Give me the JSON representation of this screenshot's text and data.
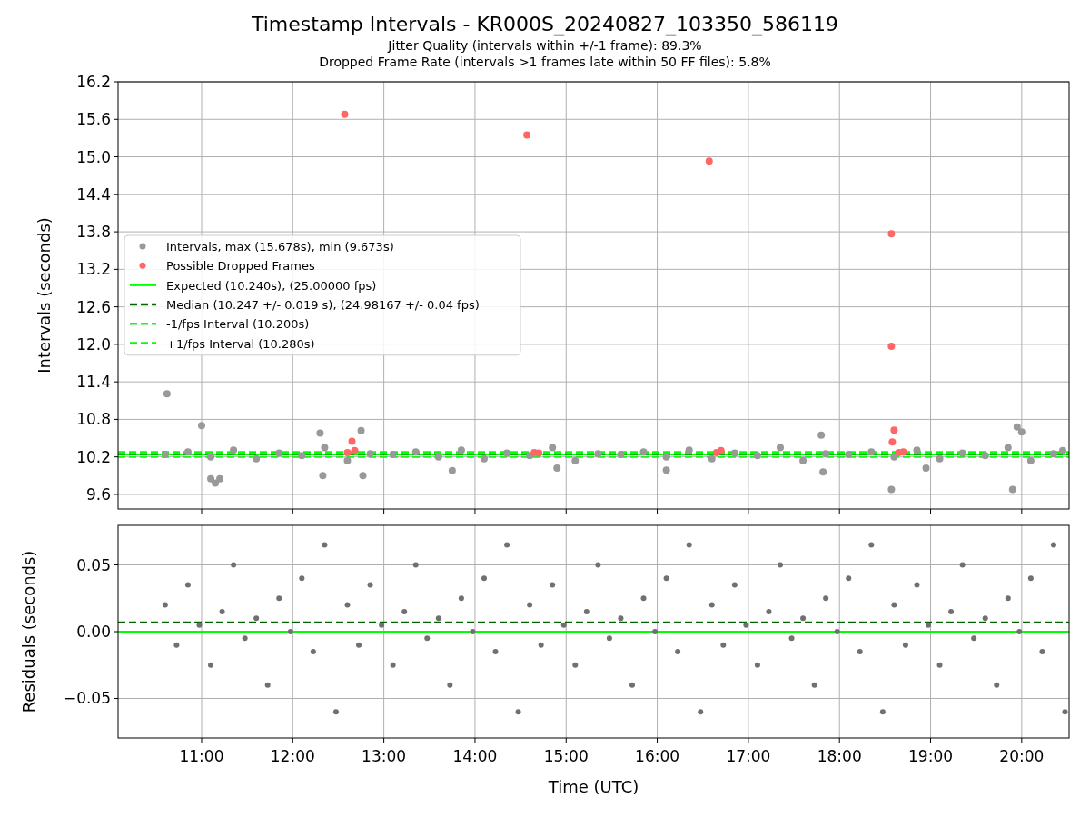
{
  "figure": {
    "title": "Timestamp Intervals - KR000S_20240827_103350_586119",
    "subtitles": [
      "Jitter Quality (intervals within +/-1 frame): 89.3%",
      "Dropped Frame Rate (intervals >1 frames late within 50 FF files): 5.8%"
    ]
  },
  "intervals_plot": {
    "chart_data": {
      "type": "scatter",
      "ylabel": "Intervals (seconds)",
      "grid": true,
      "xlim": [
        10.083,
        20.52
      ],
      "ylim": [
        9.367,
        16.2
      ],
      "yticks": [
        {
          "value": 9.6,
          "label": "9.6"
        },
        {
          "value": 10.2,
          "label": "10.2"
        },
        {
          "value": 10.8,
          "label": "10.8"
        },
        {
          "value": 11.4,
          "label": "11.4"
        },
        {
          "value": 12,
          "label": "12.0"
        },
        {
          "value": 12.6,
          "label": "12.6"
        },
        {
          "value": 13.2,
          "label": "13.2"
        },
        {
          "value": 13.8,
          "label": "13.8"
        },
        {
          "value": 14.4,
          "label": "14.4"
        },
        {
          "value": 15,
          "label": "15.0"
        },
        {
          "value": 15.6,
          "label": "15.6"
        },
        {
          "value": 16.2,
          "label": "16.2"
        }
      ],
      "series": [
        {
          "name": "Intervals, max (15.678s), min (9.673s)",
          "color": "#999999",
          "x": [
            10.6,
            10.85,
            11.1,
            11.35,
            11.6,
            11.85,
            12.1,
            12.35,
            12.6,
            12.85,
            13.1,
            13.35,
            13.6,
            13.85,
            14.1,
            14.35,
            14.6,
            14.85,
            15.1,
            15.35,
            15.6,
            15.85,
            16.1,
            16.35,
            16.6,
            16.85,
            17.1,
            17.35,
            17.6,
            17.85,
            18.1,
            18.35,
            18.6,
            18.85,
            19.1,
            19.35,
            19.6,
            19.85,
            20.1,
            20.35,
            10.62,
            11.0,
            11.1,
            11.15,
            11.2,
            12.3,
            12.33,
            12.75,
            12.77,
            13.75,
            14.9,
            16.1,
            17.8,
            17.82,
            18.57,
            18.95,
            19.9,
            19.95,
            20.0,
            20.45
          ],
          "values": [
            10.24,
            10.28,
            10.2,
            10.31,
            10.17,
            10.26,
            10.22,
            10.35,
            10.14,
            10.25,
            10.24,
            10.28,
            10.2,
            10.31,
            10.17,
            10.26,
            10.22,
            10.35,
            10.14,
            10.25,
            10.24,
            10.28,
            10.2,
            10.31,
            10.17,
            10.26,
            10.22,
            10.35,
            10.14,
            10.25,
            10.24,
            10.28,
            10.2,
            10.31,
            10.17,
            10.26,
            10.22,
            10.35,
            10.14,
            10.25,
            11.21,
            10.7,
            9.85,
            9.78,
            9.85,
            10.58,
            9.9,
            10.62,
            9.9,
            9.98,
            10.02,
            9.99,
            10.55,
            9.96,
            9.68,
            10.02,
            9.68,
            10.68,
            10.6,
            10.3
          ]
        },
        {
          "name": "Possible Dropped Frames",
          "color": "#ff6666",
          "x": [
            12.57,
            14.57,
            16.57,
            18.57,
            18.57,
            18.6,
            18.58,
            12.65,
            12.6,
            12.68,
            14.65,
            14.7,
            16.65,
            16.7,
            18.65,
            18.7
          ],
          "values": [
            15.68,
            15.35,
            14.93,
            13.77,
            11.97,
            10.63,
            10.44,
            10.45,
            10.27,
            10.3,
            10.27,
            10.26,
            10.27,
            10.3,
            10.27,
            10.28
          ]
        }
      ],
      "ref_lines": [
        {
          "axis": "y",
          "value": 10.24,
          "color": "#00ff00",
          "label": "Expected (10.240s), (25.00000 fps)"
        },
        {
          "axis": "y",
          "value": 10.247,
          "color": "#006400",
          "label": "Median (10.247 +/- 0.019 s), (24.98167 +/- 0.04 fps)"
        },
        {
          "axis": "y",
          "value": 10.2,
          "color": "#22ee22",
          "label": "-1/fps Interval (10.200s)"
        },
        {
          "axis": "y",
          "value": 10.28,
          "color": "#00ff00",
          "label": "+1/fps Interval (10.280s)"
        }
      ],
      "legend": "center left"
    }
  },
  "residuals_plot": {
    "chart_data": {
      "type": "scatter",
      "xlabel": "Time (UTC)",
      "ylabel": "Residuals (seconds)",
      "grid": true,
      "xlim": [
        10.083,
        20.52
      ],
      "ylim": [
        -0.0796,
        0.0796
      ],
      "xticks": [
        {
          "value": 11,
          "label": "11:00"
        },
        {
          "value": 12,
          "label": "12:00"
        },
        {
          "value": 13,
          "label": "13:00"
        },
        {
          "value": 14,
          "label": "14:00"
        },
        {
          "value": 15,
          "label": "15:00"
        },
        {
          "value": 16,
          "label": "16:00"
        },
        {
          "value": 17,
          "label": "17:00"
        },
        {
          "value": 18,
          "label": "18:00"
        },
        {
          "value": 19,
          "label": "19:00"
        },
        {
          "value": 20,
          "label": "20:00"
        }
      ],
      "yticks": [
        {
          "value": -0.05,
          "label": "−0.05"
        },
        {
          "value": 0,
          "label": "0.00"
        },
        {
          "value": 0.05,
          "label": "0.05"
        }
      ],
      "series": [
        {
          "color": "#707070",
          "x": [
            10.6,
            10.725,
            10.85,
            10.975,
            11.1,
            11.225,
            11.35,
            11.475,
            11.6,
            11.725,
            11.85,
            11.975,
            12.1,
            12.225,
            12.35,
            12.475,
            12.6,
            12.725,
            12.85,
            12.975,
            13.1,
            13.225,
            13.35,
            13.475,
            13.6,
            13.725,
            13.85,
            13.975,
            14.1,
            14.225,
            14.35,
            14.475,
            14.6,
            14.725,
            14.85,
            14.975,
            15.1,
            15.225,
            15.35,
            15.475,
            15.6,
            15.725,
            15.85,
            15.975,
            16.1,
            16.225,
            16.35,
            16.475,
            16.6,
            16.725,
            16.85,
            16.975,
            17.1,
            17.225,
            17.35,
            17.475,
            17.6,
            17.725,
            17.85,
            17.975,
            18.1,
            18.225,
            18.35,
            18.475,
            18.6,
            18.725,
            18.85,
            18.975,
            19.1,
            19.225,
            19.35,
            19.475,
            19.6,
            19.725,
            19.85,
            19.975,
            20.1,
            20.225,
            20.35,
            20.475
          ],
          "values": [
            0.02,
            -0.01,
            0.035,
            0.005,
            -0.025,
            0.015,
            0.05,
            -0.005,
            0.01,
            -0.04,
            0.025,
            0,
            0.04,
            -0.015,
            0.065,
            -0.06,
            0.02,
            -0.01,
            0.035,
            0.005,
            -0.025,
            0.015,
            0.05,
            -0.005,
            0.01,
            -0.04,
            0.025,
            0,
            0.04,
            -0.015,
            0.065,
            -0.06,
            0.02,
            -0.01,
            0.035,
            0.005,
            -0.025,
            0.015,
            0.05,
            -0.005,
            0.01,
            -0.04,
            0.025,
            0,
            0.04,
            -0.015,
            0.065,
            -0.06,
            0.02,
            -0.01,
            0.035,
            0.005,
            -0.025,
            0.015,
            0.05,
            -0.005,
            0.01,
            -0.04,
            0.025,
            0,
            0.04,
            -0.015,
            0.065,
            -0.06,
            0.02,
            -0.01,
            0.035,
            0.005,
            -0.025,
            0.015,
            0.05,
            -0.005,
            0.01,
            -0.04,
            0.025,
            0,
            0.04,
            -0.015,
            0.065,
            -0.06
          ]
        }
      ],
      "ref_lines": [
        {
          "axis": "y",
          "value": 0.007,
          "color": "#006400"
        },
        {
          "axis": "y",
          "value": 0,
          "color": "#00ff00"
        }
      ]
    }
  }
}
